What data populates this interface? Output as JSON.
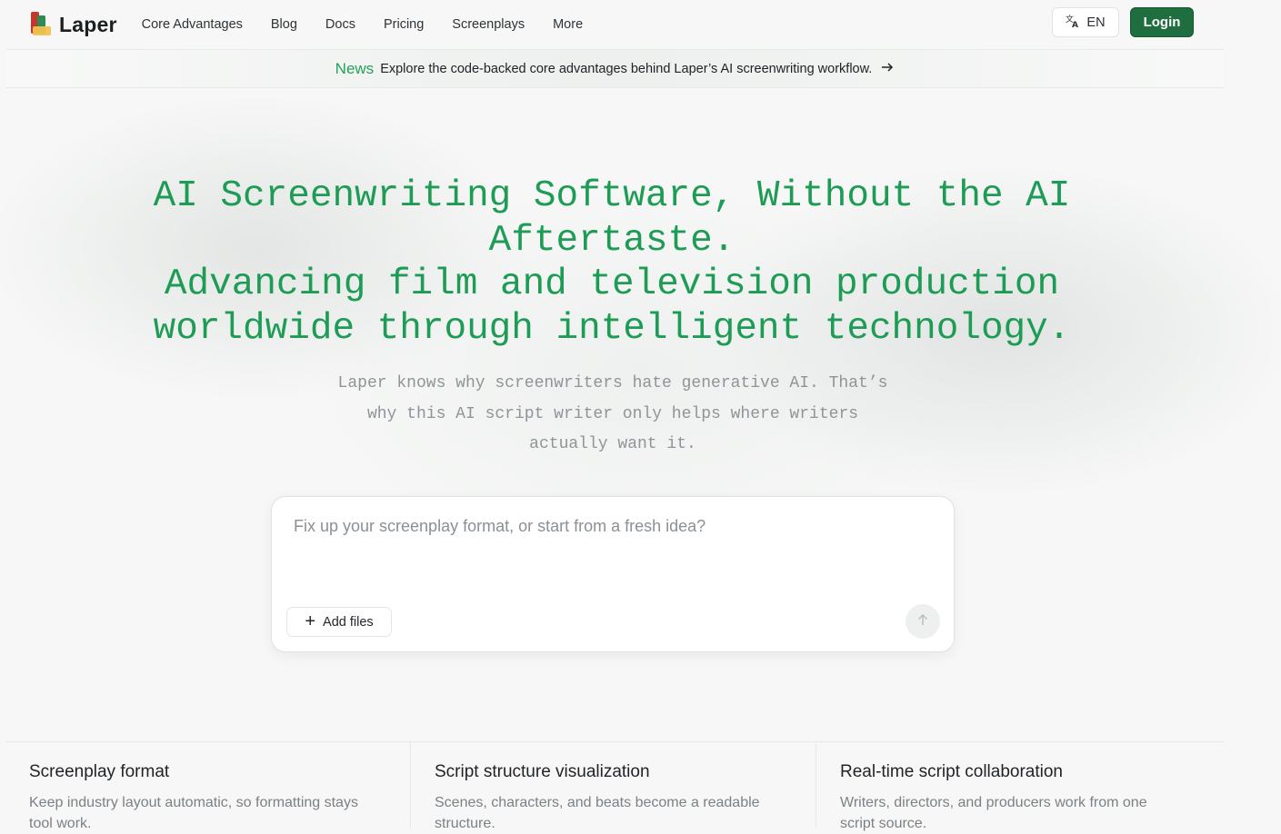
{
  "header": {
    "brand": "Laper",
    "nav": [
      {
        "label": "Core Advantages"
      },
      {
        "label": "Blog"
      },
      {
        "label": "Docs"
      },
      {
        "label": "Pricing"
      },
      {
        "label": "Screenplays"
      },
      {
        "label": "More"
      }
    ],
    "language": "EN",
    "login_label": "Login"
  },
  "news": {
    "tag": "News",
    "text": "Explore the code-backed core advantages behind Laper’s AI screenwriting workflow."
  },
  "hero": {
    "title_lines": [
      "AI Screenwriting Software, Without the AI",
      "Aftertaste.",
      "Advancing film and television production",
      "worldwide through intelligent technology."
    ],
    "subtitle_lines": [
      "Laper knows why screenwriters hate generative AI. That’s",
      "why this AI script writer only helps where writers",
      "actually want it."
    ]
  },
  "prompt": {
    "placeholder": "Fix up your screenplay format, or start from a fresh idea?",
    "add_files_label": "Add files"
  },
  "features": [
    {
      "title": "Screenplay format",
      "desc": "Keep industry layout automatic, so formatting stays tool work."
    },
    {
      "title": "Script structure visualization",
      "desc": "Scenes, characters, and beats become a readable structure."
    },
    {
      "title": "Real-time script collaboration",
      "desc": "Writers, directors, and producers work from one script source."
    }
  ],
  "colors": {
    "brand_green": "#1e9c55",
    "login_bg": "#1f6e3f",
    "news_tag": "#22a05a"
  },
  "icons": {
    "language": "translate-icon",
    "news_arrow": "arrow-right-icon",
    "add_files": "plus-icon",
    "send": "arrow-up-icon"
  }
}
